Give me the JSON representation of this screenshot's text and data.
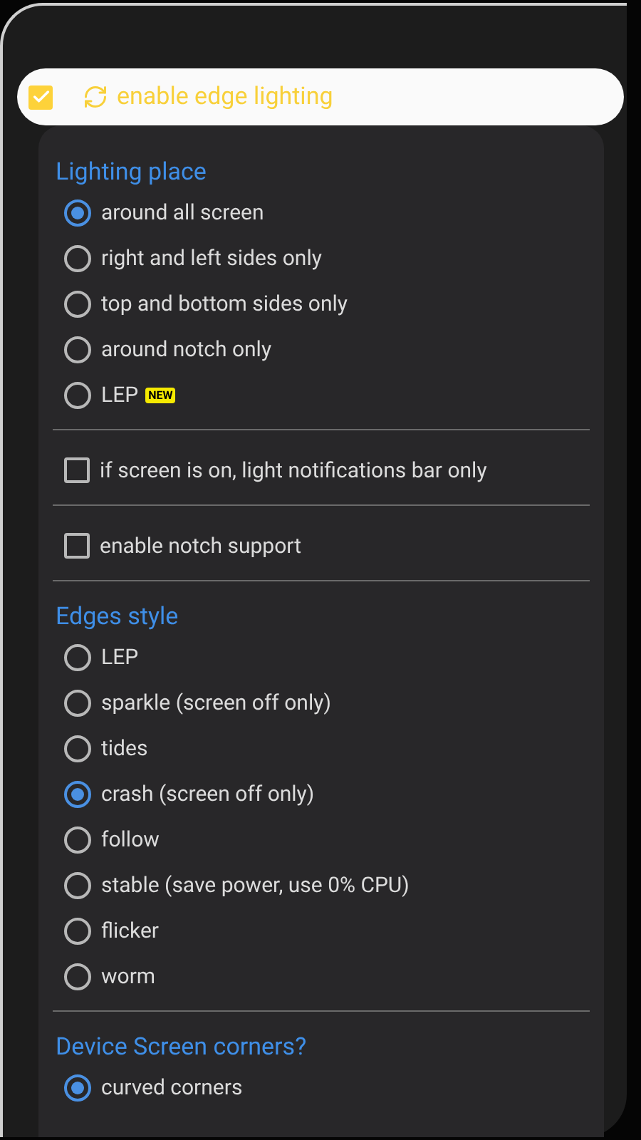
{
  "header": {
    "label": "enable edge lighting",
    "checked": true
  },
  "sections": [
    {
      "kind": "radio_group",
      "title": "Lighting place",
      "options": [
        {
          "label": "around all screen",
          "selected": true
        },
        {
          "label": "right and left sides only",
          "selected": false
        },
        {
          "label": "top and bottom sides only",
          "selected": false
        },
        {
          "label": "around notch only",
          "selected": false
        },
        {
          "label": "LEP",
          "badge": "NEW",
          "selected": false
        }
      ]
    },
    {
      "kind": "checkbox",
      "label": "if screen is on, light notifications bar only",
      "checked": false
    },
    {
      "kind": "checkbox",
      "label": "enable notch support",
      "checked": false
    },
    {
      "kind": "radio_group",
      "title": "Edges style",
      "options": [
        {
          "label": "LEP",
          "selected": false
        },
        {
          "label": "sparkle (screen off only)",
          "selected": false
        },
        {
          "label": "tides",
          "selected": false
        },
        {
          "label": "crash (screen off only)",
          "selected": true
        },
        {
          "label": "follow",
          "selected": false
        },
        {
          "label": "stable (save power, use 0% CPU)",
          "selected": false
        },
        {
          "label": "flicker",
          "selected": false
        },
        {
          "label": "worm",
          "selected": false
        }
      ]
    },
    {
      "kind": "radio_group",
      "title": "Device Screen corners?",
      "options": [
        {
          "label": "curved corners",
          "selected": true
        }
      ]
    }
  ]
}
